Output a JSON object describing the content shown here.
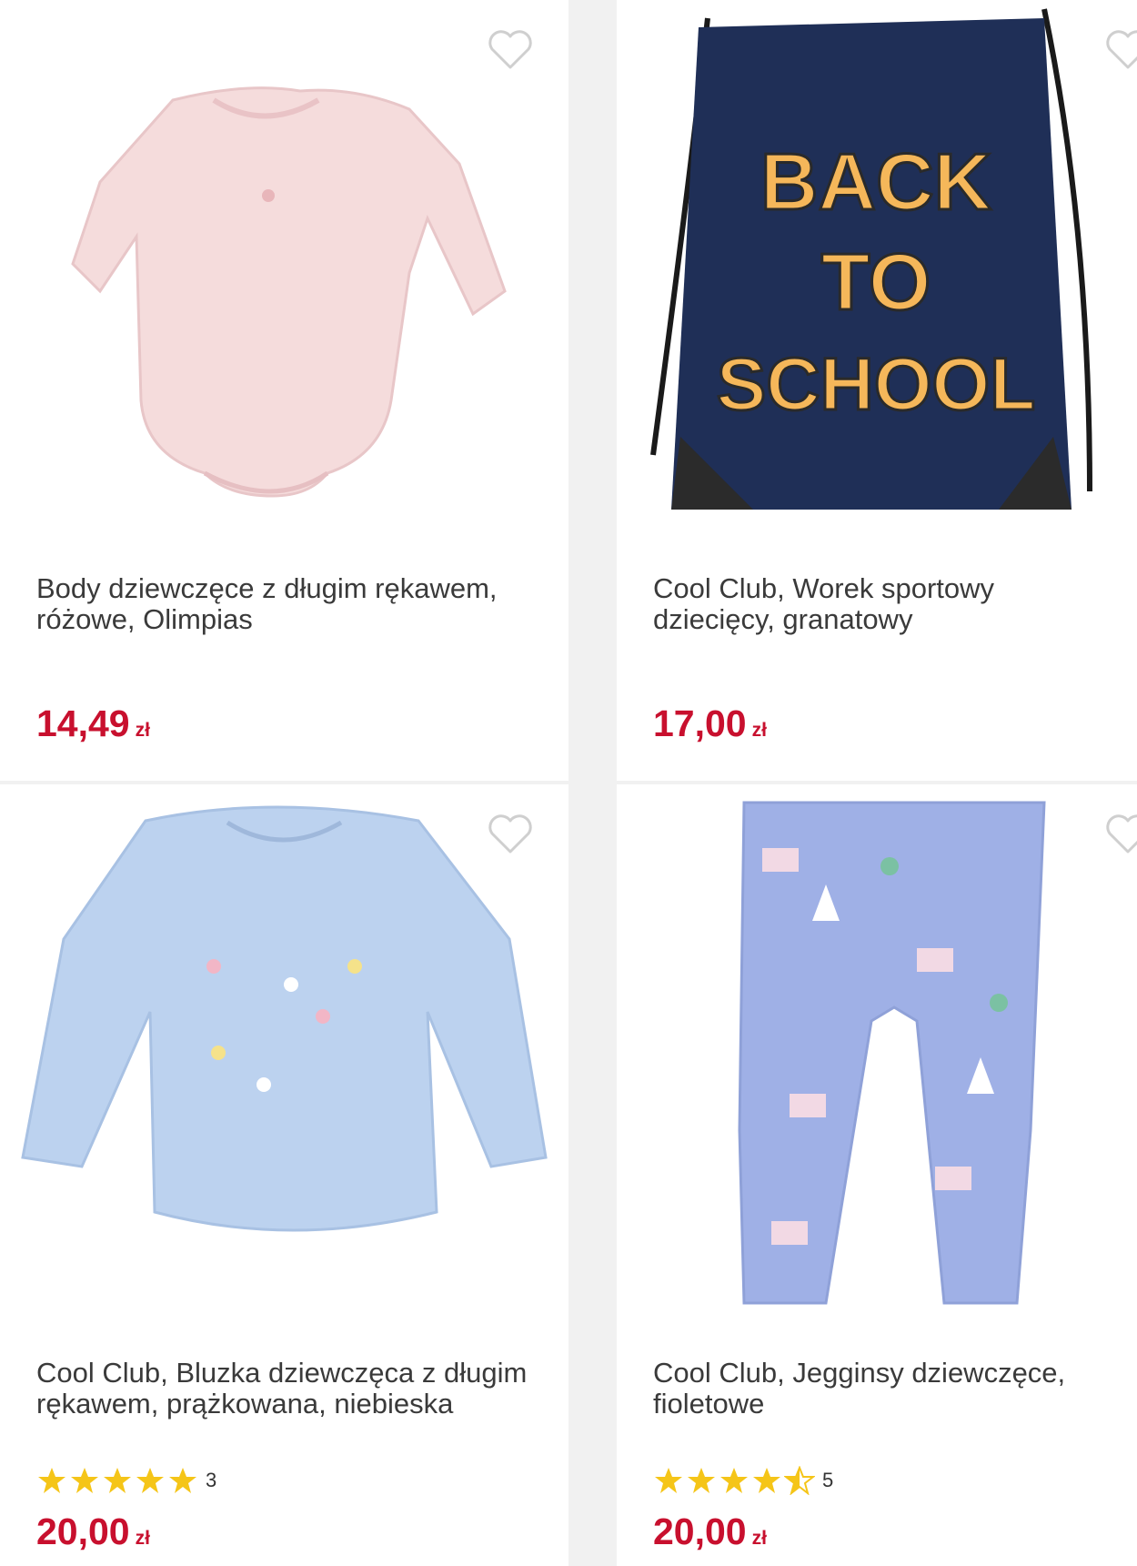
{
  "products": [
    {
      "title": "Body dziewczęce z długim rękawem, różowe, Olimpias",
      "price": "14,49",
      "currency": "zł"
    },
    {
      "title": "Cool Club, Worek sportowy dziecięcy, granatowy",
      "price": "17,00",
      "currency": "zł",
      "image_text": [
        "BACK",
        "TO",
        "SCHOOL"
      ]
    },
    {
      "title": "Cool Club, Bluzka dziewczęca z długim rękawem, prążkowana, niebieska",
      "rating_stars": 5,
      "rating_count": "3",
      "price": "20,00",
      "currency": "zł"
    },
    {
      "title": "Cool Club, Jegginsy dziewczęce, fioletowe",
      "rating_stars": 4.5,
      "rating_count": "5",
      "price": "20,00",
      "currency": "zł"
    }
  ],
  "colors": {
    "price": "#c8102e",
    "star": "#f5c518",
    "heart_outline": "#cfcfcf"
  },
  "icons": {
    "favorite": "heart-outline-icon",
    "rating": "star-icon"
  }
}
